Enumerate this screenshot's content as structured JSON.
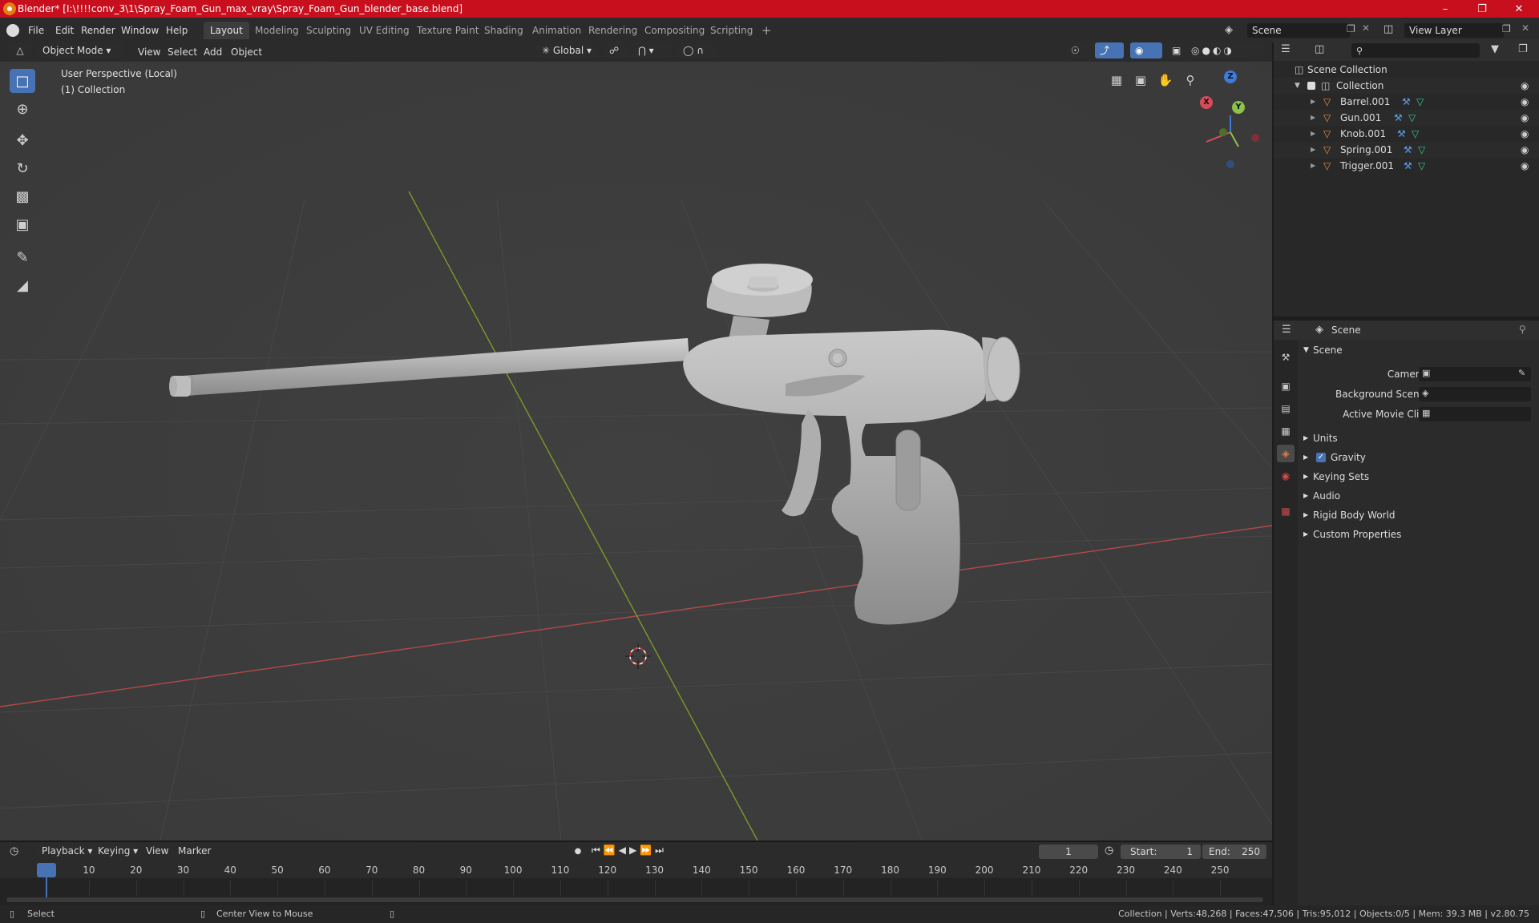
{
  "window": {
    "title": "Blender* [I:\\!!!!conv_3\\1\\Spray_Foam_Gun_max_vray\\Spray_Foam_Gun_blender_base.blend]",
    "minimize": "–",
    "maximize": "❐",
    "close": "✕"
  },
  "menu": [
    "File",
    "Edit",
    "Render",
    "Window",
    "Help"
  ],
  "workspaces": [
    {
      "label": "Layout",
      "active": true
    },
    {
      "label": "Modeling"
    },
    {
      "label": "Sculpting"
    },
    {
      "label": "UV Editing"
    },
    {
      "label": "Texture Paint"
    },
    {
      "label": "Shading"
    },
    {
      "label": "Animation"
    },
    {
      "label": "Rendering"
    },
    {
      "label": "Compositing"
    },
    {
      "label": "Scripting"
    }
  ],
  "add_workspace": "+",
  "scene_field": "Scene",
  "view_layer_field": "View Layer",
  "viewport": {
    "mode": "Object Mode",
    "menus": [
      "View",
      "Select",
      "Add",
      "Object"
    ],
    "orientation": "Global",
    "overlay_line1": "User Perspective (Local)",
    "overlay_line2": "(1) Collection",
    "gizmo": {
      "x": "X",
      "y": "Y",
      "z": "Z"
    }
  },
  "outliner": {
    "root": "Scene Collection",
    "collection": "Collection",
    "objects": [
      "Barrel.001",
      "Gun.001",
      "Knob.001",
      "Spring.001",
      "Trigger.001"
    ]
  },
  "properties": {
    "header": "Scene",
    "panel": "Scene",
    "camera_label": "Camera",
    "background_scene_label": "Background Scene",
    "active_movie_clip_label": "Active Movie Clip",
    "sections": [
      "Units",
      "Gravity",
      "Keying Sets",
      "Audio",
      "Rigid Body World",
      "Custom Properties"
    ]
  },
  "timeline": {
    "menus": [
      "Playback",
      "Keying",
      "View",
      "Marker"
    ],
    "current_frame": "1",
    "start_label": "Start:",
    "start": "1",
    "end_label": "End:",
    "end": "250",
    "ticks": [
      "1",
      "10",
      "20",
      "30",
      "40",
      "50",
      "60",
      "70",
      "80",
      "90",
      "100",
      "110",
      "120",
      "130",
      "140",
      "150",
      "160",
      "170",
      "180",
      "190",
      "200",
      "210",
      "220",
      "230",
      "240",
      "250"
    ]
  },
  "status": {
    "left1": "Select",
    "left2": "Center View to Mouse",
    "right": "Collection | Verts:48,268 | Faces:47,506 | Tris:95,012 | Objects:0/5 | Mem: 39.3 MB | v2.80.75"
  },
  "colors": {
    "titlebar": "#c80f1e",
    "accent": "#4772b3",
    "x_axis": "#d94b5a",
    "y_axis": "#8bc34a",
    "z_axis": "#3f7bd9"
  }
}
